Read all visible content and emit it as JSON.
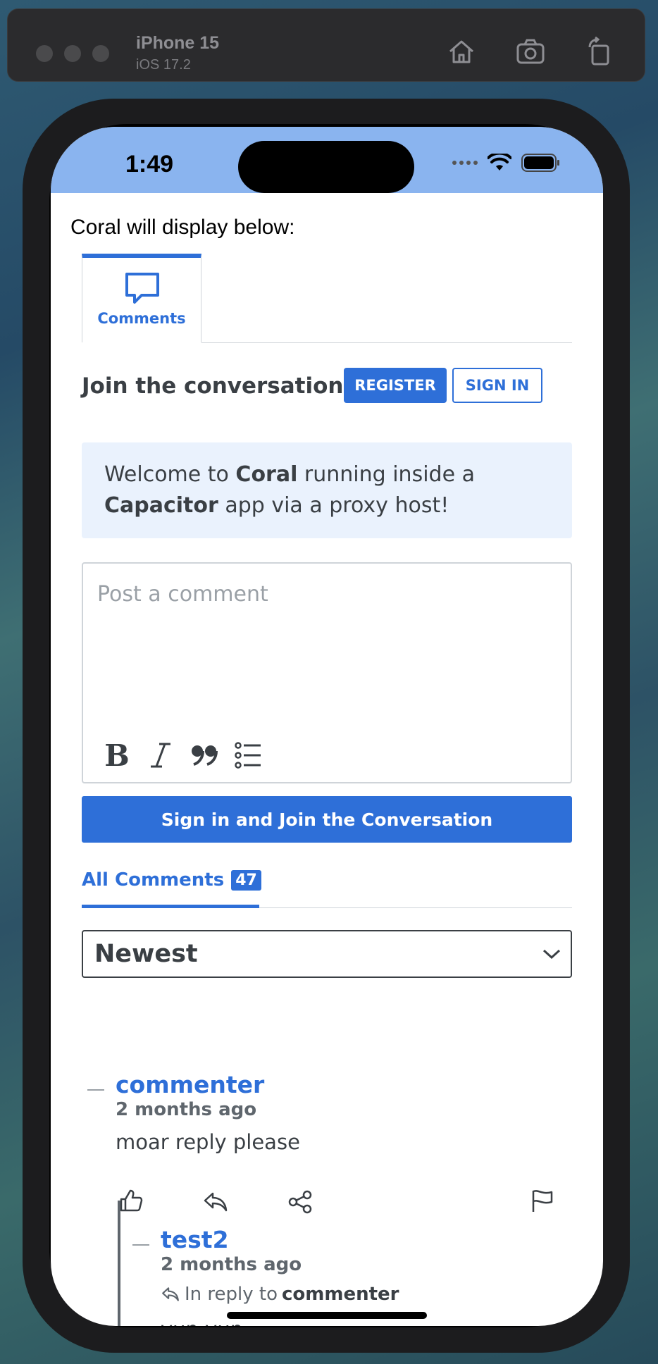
{
  "simulator": {
    "device_name": "iPhone 15",
    "os_version": "iOS 17.2",
    "home_icon": "home-icon",
    "screenshot_icon": "camera-icon",
    "rotate_icon": "rotate-icon"
  },
  "status_bar": {
    "time": "1:49",
    "background": "#8ab4ef"
  },
  "page": {
    "intro_text": "Coral will display below:"
  },
  "coral": {
    "tab_label": "Comments",
    "join_title": "Join the conversation",
    "register_label": "REGISTER",
    "signin_label": "SIGN IN",
    "welcome": {
      "part1": "Welcome to ",
      "bold1": "Coral",
      "part2": " running inside a ",
      "bold2": "Capacitor",
      "part3": " app via a proxy host!"
    },
    "composer_placeholder": "Post a comment",
    "submit_label": "Sign in and Join the Conversation",
    "all_comments_label": "All Comments",
    "comment_count": "47",
    "sort_value": "Newest",
    "accent_color": "#2e6fd8"
  },
  "comments": [
    {
      "username": "commenter",
      "timestamp": "2 months ago",
      "body": "moar reply please"
    },
    {
      "username": "test2",
      "timestamp": "2 months ago",
      "in_reply_prefix": "In reply to",
      "in_reply_to": "commenter",
      "body": "yup yup"
    }
  ]
}
